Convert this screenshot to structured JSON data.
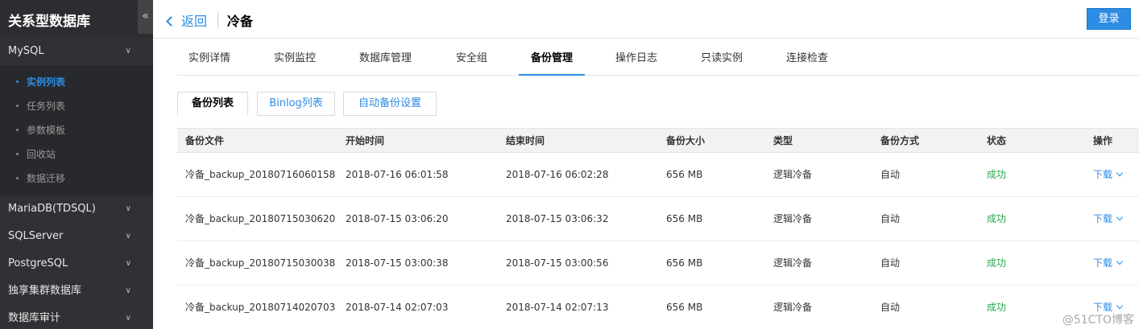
{
  "sidebar": {
    "title": "关系型数据库",
    "collapse_icon": "«",
    "open_group": "MySQL",
    "items": [
      {
        "label": "实例列表",
        "active": true
      },
      {
        "label": "任务列表",
        "active": false
      },
      {
        "label": "参数模板",
        "active": false
      },
      {
        "label": "回收站",
        "active": false
      },
      {
        "label": "数据迁移",
        "active": false
      }
    ],
    "groups": [
      "MariaDB(TDSQL)",
      "SQLServer",
      "PostgreSQL",
      "独享集群数据库",
      "数据库审计"
    ]
  },
  "topbar": {
    "back_label": "返回",
    "title": "冷备",
    "login_label": "登录"
  },
  "tabs": [
    "实例详情",
    "实例监控",
    "数据库管理",
    "安全组",
    "备份管理",
    "操作日志",
    "只读实例",
    "连接检查"
  ],
  "active_tab": "备份管理",
  "subtabs": [
    "备份列表",
    "Binlog列表",
    "自动备份设置"
  ],
  "active_subtab": "备份列表",
  "table": {
    "columns": [
      "备份文件",
      "开始时间",
      "结束时间",
      "备份大小",
      "类型",
      "备份方式",
      "状态",
      "操作"
    ],
    "rows": [
      [
        "冷备_backup_20180716060158",
        "2018-07-16 06:01:58",
        "2018-07-16 06:02:28",
        "656 MB",
        "逻辑冷备",
        "自动",
        "成功",
        "下载"
      ],
      [
        "冷备_backup_20180715030620",
        "2018-07-15 03:06:20",
        "2018-07-15 03:06:32",
        "656 MB",
        "逻辑冷备",
        "自动",
        "成功",
        "下载"
      ],
      [
        "冷备_backup_20180715030038",
        "2018-07-15 03:00:38",
        "2018-07-15 03:00:56",
        "656 MB",
        "逻辑冷备",
        "自动",
        "成功",
        "下载"
      ],
      [
        "冷备_backup_20180714020703",
        "2018-07-14 02:07:03",
        "2018-07-14 02:07:13",
        "656 MB",
        "逻辑冷备",
        "自动",
        "成功",
        "下载"
      ]
    ]
  },
  "watermark": "@51CTO博客",
  "colors": {
    "accent": "#2d8ce4",
    "success": "#27a84e",
    "sidebar_bg": "#2b2d30"
  }
}
